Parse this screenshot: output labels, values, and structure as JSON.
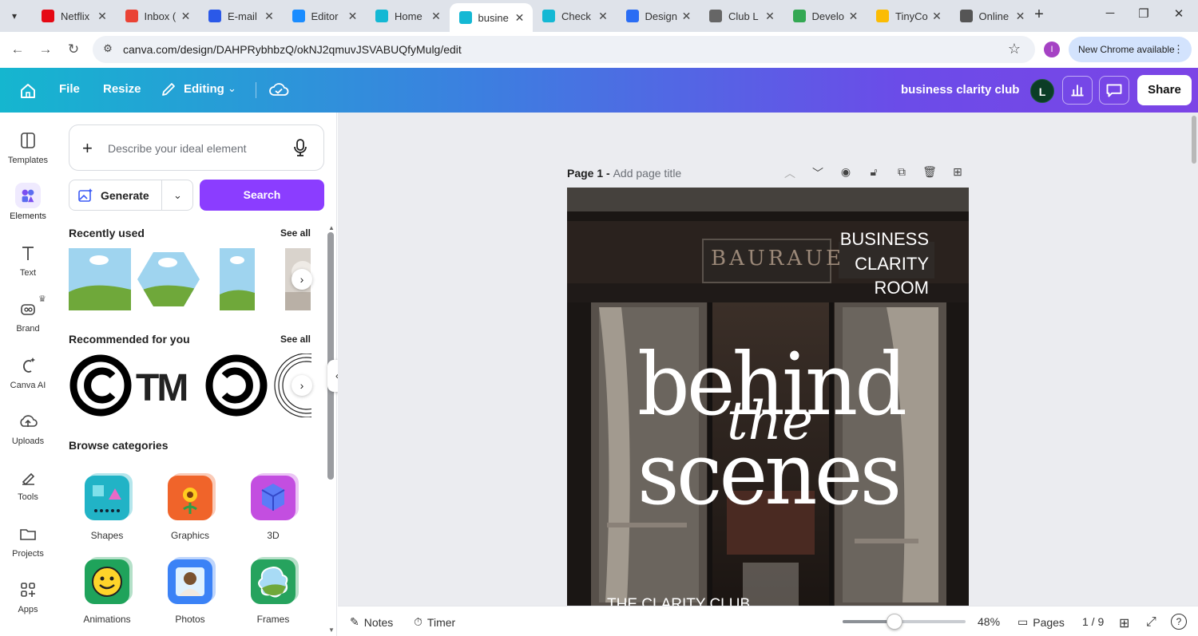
{
  "browser": {
    "tabs": [
      {
        "title": "Netflix",
        "favicon": "netflix-icon",
        "color": "#e50914"
      },
      {
        "title": "Inbox (",
        "favicon": "gmail-icon",
        "color": "#ea4335"
      },
      {
        "title": "E-mail",
        "favicon": "mail-icon",
        "color": "#2b59e8"
      },
      {
        "title": "Editor",
        "favicon": "editor-icon",
        "color": "#1a8cff"
      },
      {
        "title": "Home",
        "favicon": "canva-icon",
        "color": "#14b8d4"
      },
      {
        "title": "busine",
        "favicon": "canva-icon",
        "color": "#14b8d4"
      },
      {
        "title": "Check",
        "favicon": "canva-icon",
        "color": "#14b8d4"
      },
      {
        "title": "Design",
        "favicon": "design-icon",
        "color": "#2a6df4"
      },
      {
        "title": "Club L",
        "favicon": "globe-icon",
        "color": "#666666"
      },
      {
        "title": "Develo",
        "favicon": "drive-icon",
        "color": "#34a853"
      },
      {
        "title": "TinyCo",
        "favicon": "drive-icon",
        "color": "#fbbc04"
      },
      {
        "title": "Online",
        "favicon": "openai-icon",
        "color": "#555555"
      }
    ],
    "active_tab_index": 5,
    "url": "canva.com/design/DAHPRybhbzQ/okNJ2qmuvJSVABUQfyMulg/edit",
    "profile_initial": "I",
    "update_label": "New Chrome available"
  },
  "header": {
    "file": "File",
    "resize": "Resize",
    "editing": "Editing",
    "design_title": "business clarity club",
    "avatar_initial": "L",
    "share": "Share"
  },
  "rail": [
    {
      "label": "Templates",
      "icon": "templates-icon"
    },
    {
      "label": "Elements",
      "icon": "elements-icon",
      "active": true
    },
    {
      "label": "Text",
      "icon": "text-icon"
    },
    {
      "label": "Brand",
      "icon": "brand-icon"
    },
    {
      "label": "Canva AI",
      "icon": "canva-ai-icon"
    },
    {
      "label": "Uploads",
      "icon": "uploads-icon"
    },
    {
      "label": "Tools",
      "icon": "tools-icon"
    },
    {
      "label": "Projects",
      "icon": "projects-icon"
    },
    {
      "label": "Apps",
      "icon": "apps-icon"
    }
  ],
  "panel": {
    "search_placeholder": "Describe your ideal element",
    "generate": "Generate",
    "search": "Search",
    "recently_used": "Recently used",
    "recommended": "Recommended for you",
    "see_all": "See all",
    "browse": "Browse categories",
    "recommended_items": [
      "©",
      "TM",
      "copyleft",
      "rings"
    ],
    "categories": [
      {
        "label": "Shapes",
        "color": "#21b3c6"
      },
      {
        "label": "Graphics",
        "color": "#f0642a"
      },
      {
        "label": "3D",
        "color": "#c34ee0"
      },
      {
        "label": "Animations",
        "color": "#1fa35b"
      },
      {
        "label": "Photos",
        "color": "#3b82f6"
      },
      {
        "label": "Frames",
        "color": "#26a35e"
      }
    ]
  },
  "page": {
    "label": "Page 1 - ",
    "title_placeholder": "Add page title"
  },
  "design": {
    "sign": "BAURAUE",
    "heading": [
      "BUSINESS",
      "CLARITY",
      "ROOM"
    ],
    "big1": "behind",
    "script": "the",
    "big2": "scenes",
    "footer": "THE CLARITY CLUB"
  },
  "bottombar": {
    "notes": "Notes",
    "timer": "Timer",
    "zoom": "48%",
    "zoom_fraction": 0.42,
    "pages": "Pages",
    "page_count": "1 / 9"
  }
}
